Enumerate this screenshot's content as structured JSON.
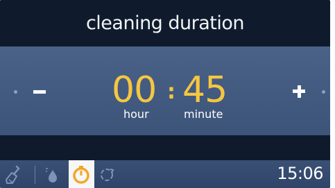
{
  "header": {
    "title": "cleaning duration"
  },
  "duration": {
    "hours": "00",
    "separator": ":",
    "minutes": "45",
    "hour_label": "hour",
    "minute_label": "minute"
  },
  "controls": {
    "decrease_icon": "minus-icon",
    "increase_icon": "plus-icon"
  },
  "status_bar": {
    "icons": [
      "cleaning-brush-icon",
      "water-drop-icon",
      "timer-icon",
      "cycle-icon"
    ],
    "active_icon": "timer-icon",
    "clock": "15:06"
  },
  "colors": {
    "accent": "#f5c740",
    "panel": "#4a6288",
    "background": "#0e1a2c",
    "status_bar": "#3a5175"
  }
}
